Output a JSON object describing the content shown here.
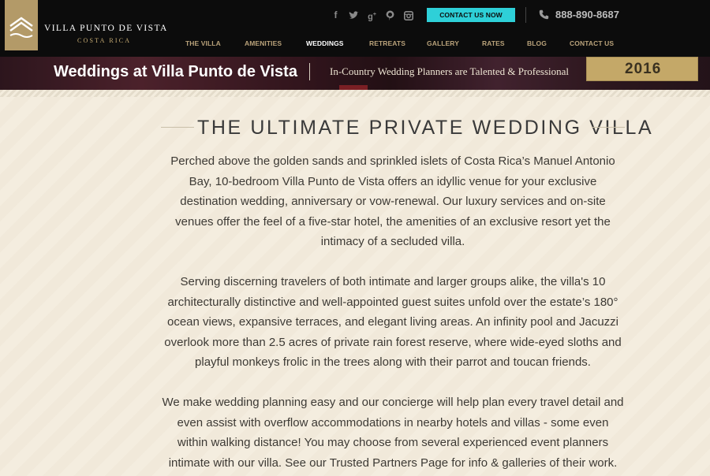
{
  "header": {
    "brand_name": "VILLA PUNTO DE VISTA",
    "brand_sub": "COSTA RICA",
    "social_icons": [
      "facebook-icon",
      "twitter-icon",
      "google-plus-icon",
      "pinterest-icon",
      "instagram-icon"
    ],
    "contact_button": "CONTACT US NOW",
    "phone": "888-890-8687",
    "nav": [
      {
        "label": "THE VILLA",
        "active": false
      },
      {
        "label": "AMENITIES",
        "active": false
      },
      {
        "label": "WEDDINGS",
        "active": true
      },
      {
        "label": "RETREATS",
        "active": false
      },
      {
        "label": "GALLERY",
        "active": false
      },
      {
        "label": "RATES",
        "active": false
      },
      {
        "label": "BLOG",
        "active": false
      },
      {
        "label": "CONTACT US",
        "active": false
      }
    ]
  },
  "banner": {
    "title": "Weddings at Villa Punto de Vista",
    "tagline": "In-Country Wedding Planners are Talented & Professional",
    "badge_year": "2016"
  },
  "main": {
    "heading": "THE ULTIMATE PRIVATE WEDDING VILLA",
    "paragraphs": [
      "Perched above the golden sands and sprinkled islets of Costa Rica’s Manuel Antonio Bay, 10-bedroom Villa Punto de Vista offers an idyllic venue for your exclusive destination wedding, anniversary or vow-renewal. Our luxury services and on-site venues offer the feel of a five-star hotel, the amenities of an exclusive resort yet the intimacy of a secluded villa.",
      "Serving discerning travelers of both intimate and larger groups alike, the villa's 10 architecturally distinctive and well-appointed guest suites unfold over the estate’s 180° ocean views, expansive terraces, and elegant living areas. An infinity pool and Jacuzzi overlook more than 2.5 acres of private rain forest reserve, where wide-eyed sloths and playful monkeys frolic in the trees along with their parrot and toucan friends.",
      "We make wedding planning easy and our concierge will help plan every travel detail and even assist with overflow accommodations in nearby hotels and villas - some even within walking distance! You may choose from several experienced event planners intimate with our villa. See our Trusted Partners Page for info & galleries of their work."
    ]
  },
  "colors": {
    "header_bg": "#0c0c0c",
    "gold": "#b39a68",
    "cta": "#2ed0d8",
    "page_bg": "#f3ecdd"
  }
}
